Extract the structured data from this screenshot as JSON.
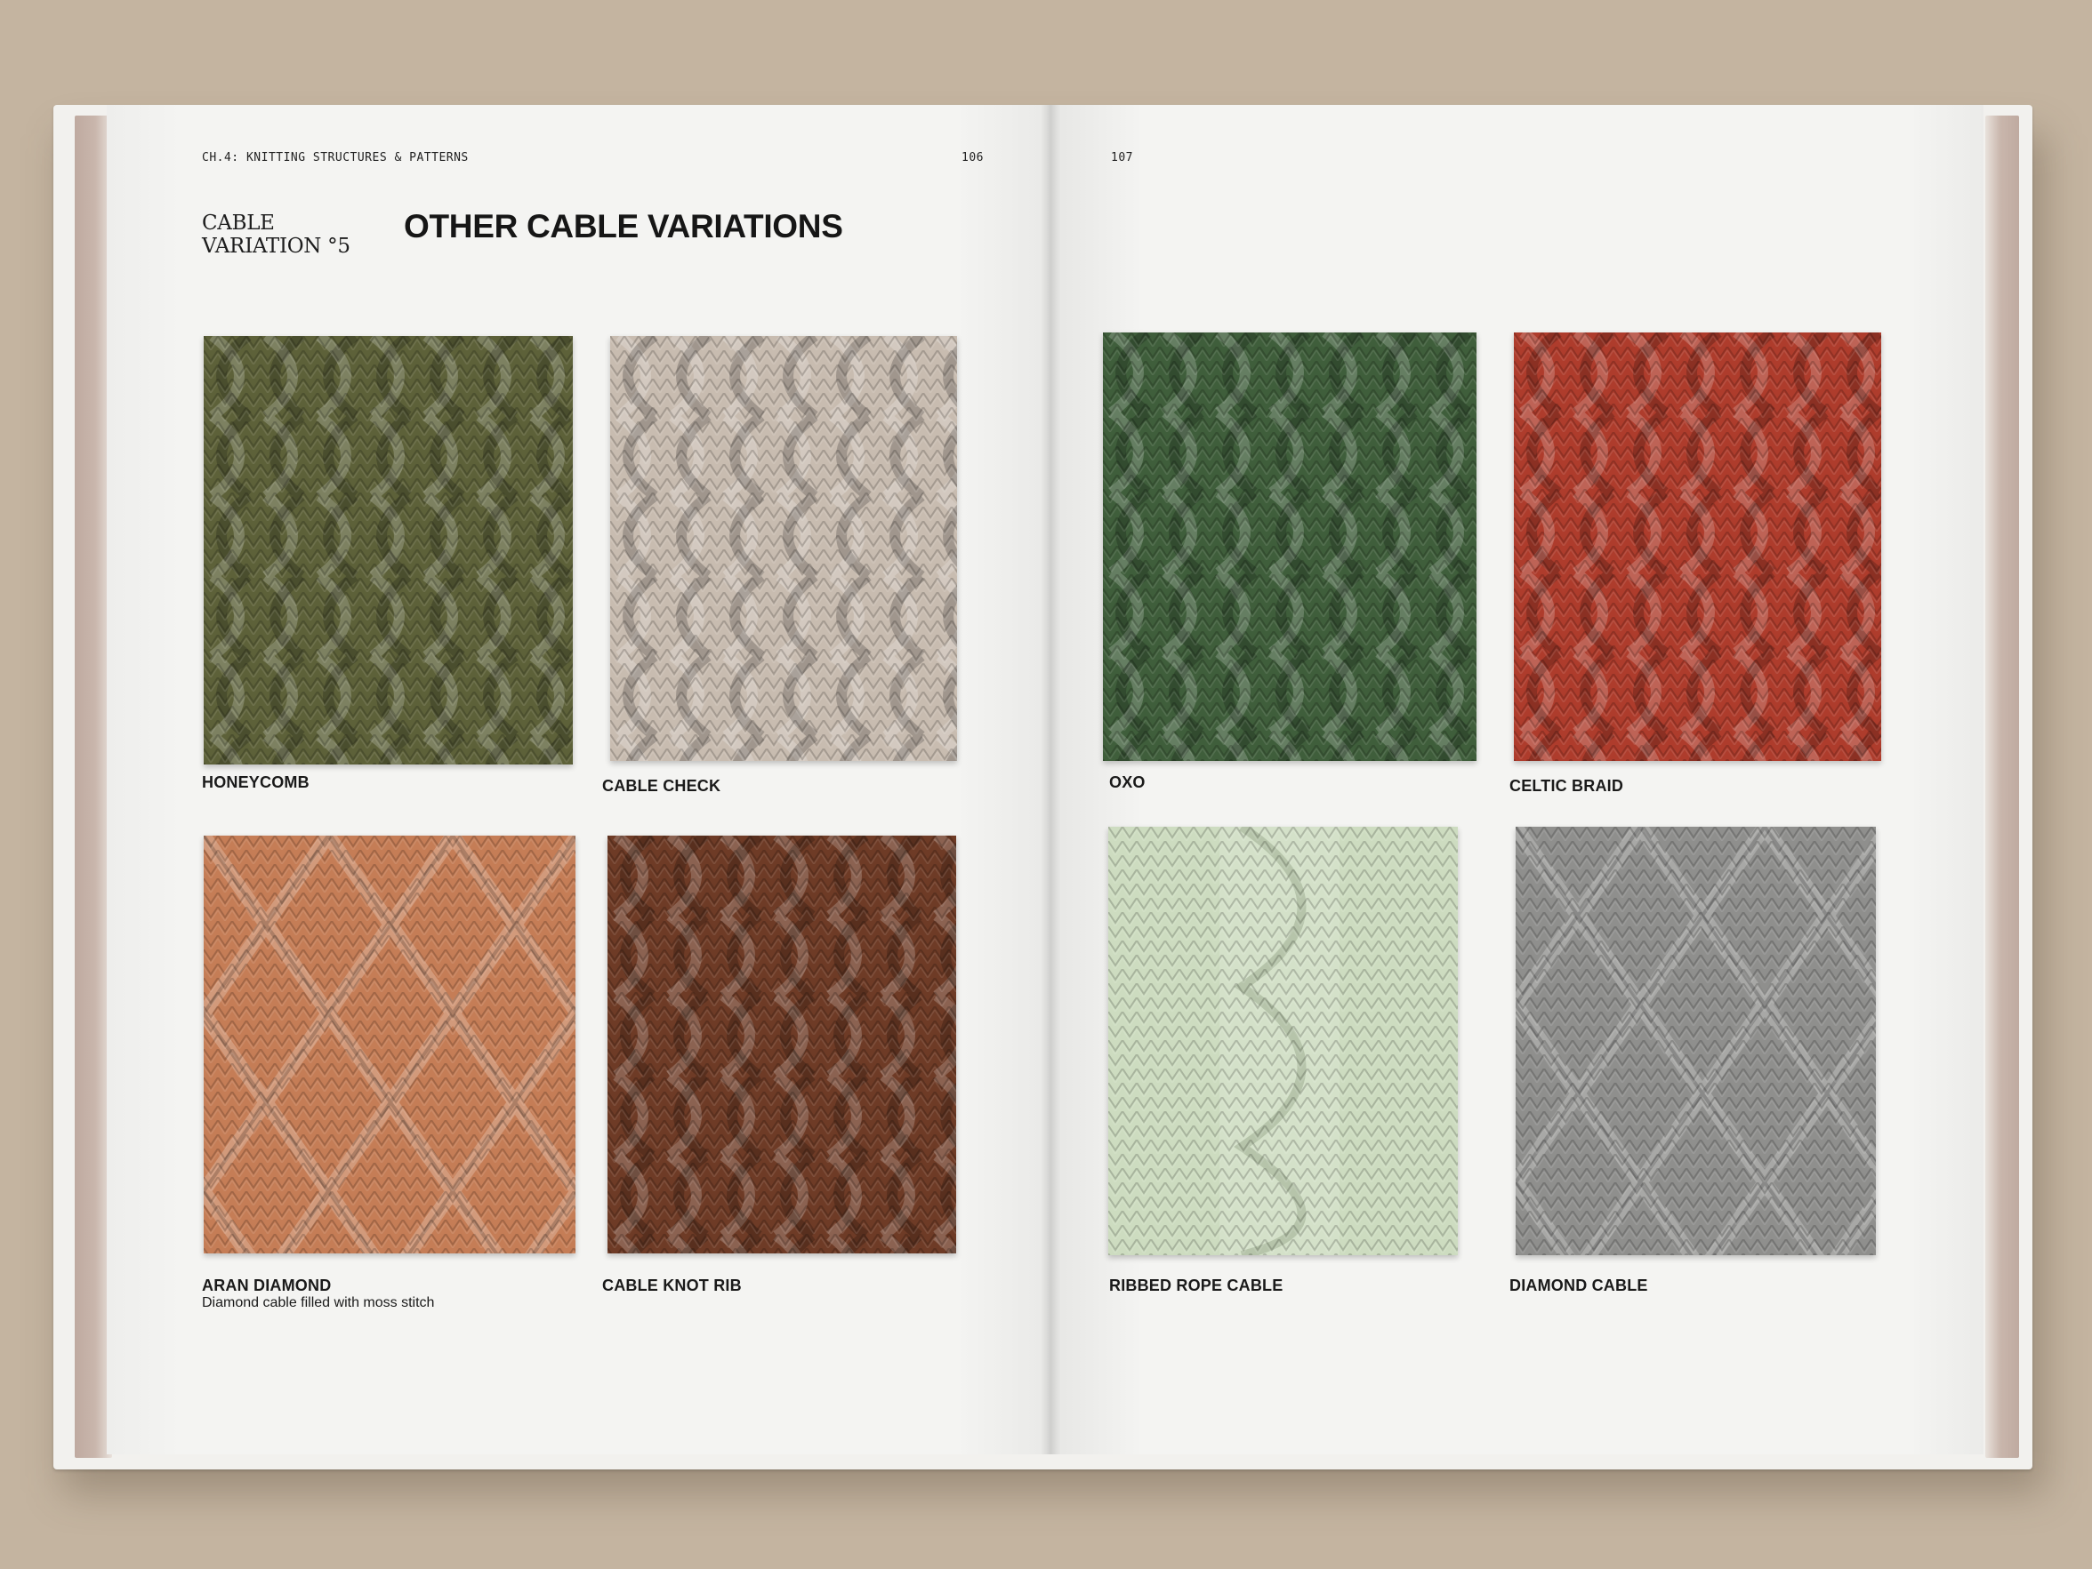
{
  "spread": {
    "left_page": {
      "running_head": "CH.4: KNITTING STRUCTURES & PATTERNS",
      "page_number": "106",
      "variation_label_line1": "CABLE",
      "variation_label_line2": "VARIATION °5",
      "title": "OTHER CABLE VARIATIONS",
      "swatches": [
        {
          "label": "HONEYCOMB",
          "color": "#5d6139"
        },
        {
          "label": "CABLE CHECK",
          "color": "#c8bcb0"
        },
        {
          "label": "ARAN DIAMOND",
          "sublabel": "Diamond cable filled with moss stitch",
          "color": "#c57d56"
        },
        {
          "label": "CABLE KNOT RIB",
          "color": "#6e3b26"
        }
      ]
    },
    "right_page": {
      "page_number": "107",
      "swatches": [
        {
          "label": "OXO",
          "color": "#3f5e3b"
        },
        {
          "label": "CELTIC BRAID",
          "color": "#ae3c2c"
        },
        {
          "label": "RIBBED ROPE CABLE",
          "color": "#cddcc0"
        },
        {
          "label": "DIAMOND CABLE",
          "color": "#8f8f8d"
        }
      ]
    }
  }
}
